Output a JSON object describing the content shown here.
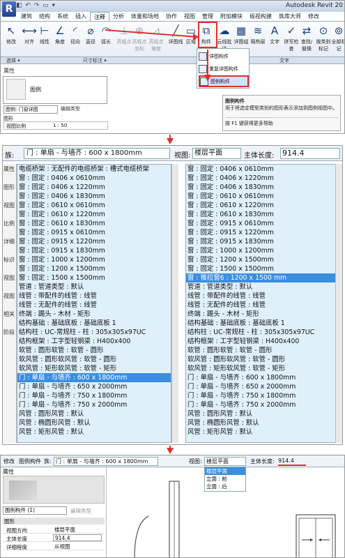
{
  "panel1": {
    "app_title": "Autodesk Revit 20",
    "logo": "R",
    "quick_access": "◧ ↶ ↷ ▭ ▾",
    "ribbon_tabs": [
      "建筑",
      "结构",
      "系统",
      "插入",
      "注释",
      "分析",
      "体量和场地",
      "协作",
      "视图",
      "管理",
      "附加模块",
      "极视构建",
      "族库大师",
      "修改"
    ],
    "ribbon_buttons": [
      {
        "label": "修改",
        "icon": "cursor-icon"
      },
      {
        "label": "对齐",
        "icon": "align-dim-icon"
      },
      {
        "label": "线性",
        "icon": "linear-dim-icon"
      },
      {
        "label": "角度",
        "icon": "angle-dim-icon"
      },
      {
        "label": "径向",
        "icon": "radial-dim-icon"
      },
      {
        "label": "直径",
        "icon": "diameter-dim-icon"
      },
      {
        "label": "弧长",
        "icon": "arc-length-icon"
      },
      {
        "label": "高程点",
        "icon": "spot-elevation-icon"
      },
      {
        "label": "高程点坐标",
        "icon": "spot-coordinate-icon"
      },
      {
        "label": "高程点坡度",
        "icon": "spot-slope-icon"
      },
      {
        "label": "详图线",
        "icon": "detail-line-icon"
      },
      {
        "label": "区域",
        "icon": "region-icon"
      },
      {
        "label": "构件",
        "icon": "component-icon"
      },
      {
        "label": "云线批注",
        "icon": "revision-cloud-icon"
      },
      {
        "label": "详图组",
        "icon": "detail-group-icon"
      },
      {
        "label": "隔热层",
        "icon": "insulation-icon"
      },
      {
        "label": "文字",
        "icon": "text-icon"
      },
      {
        "label": "拼写检查",
        "icon": "spell-check-icon"
      },
      {
        "label": "查找/替换",
        "icon": "find-replace-icon"
      },
      {
        "label": "按类别标记",
        "icon": "tag-by-category-icon"
      },
      {
        "label": "全部标记",
        "icon": "tag-all-icon"
      }
    ],
    "ribbon_groups": [
      "选择 ▾",
      "尺寸标注 ▾",
      "详图",
      "文字"
    ],
    "component_menu": [
      "详图构件",
      "重复详图构件",
      "图例构件"
    ],
    "tooltip": {
      "title": "图例构件",
      "desc": "用于将选定模型类别的图形表示添加到图例视图中。",
      "help": "按 F1 键获得更多帮助"
    },
    "properties": {
      "title": "属性",
      "legend_name": "图例",
      "legend_select": "图例: 门窗详图",
      "edit_type": "编辑类型",
      "category": "图形",
      "view_scale_label": "视图比例",
      "view_scale_value": "1 : 50"
    }
  },
  "panel2": {
    "type_label": "族:",
    "type_value": "门 : 单扇 - 与墙齐 : 600 x 1800mm",
    "view_label": "视图:",
    "view_value": "楼层平面",
    "host_length_label": "主体长度:",
    "host_length_value": "914.4",
    "side_labels": [
      "属性",
      "图形",
      "视图",
      "比例",
      "详细",
      "标识",
      "视图",
      "视图",
      "相关",
      "阶段"
    ],
    "left_list": [
      "电缆桥架 : 无配件的电缆桥架 : 槽式电缆桥架",
      "窗 : 固定 : 0406 x 0610mm",
      "窗 : 固定 : 0406 x 1220mm",
      "窗 : 固定 : 0406 x 1830mm",
      "窗 : 固定 : 0610 x 0610mm",
      "窗 : 固定 : 0610 x 1220mm",
      "窗 : 固定 : 0610 x 1830mm",
      "窗 : 固定 : 0915 x 0610mm",
      "窗 : 固定 : 0915 x 1220mm",
      "窗 : 固定 : 0915 x 1830mm",
      "窗 : 固定 : 1000 x 1200mm",
      "窗 : 固定 : 1200 x 1500mm",
      "窗 : 固定 : 1500 x 1500mm",
      "管道 : 管道类型 : 默认",
      "线管 : 带配件的线管 : 线管",
      "线管 : 无配件的线管 : 线管",
      "终端 : 踢头 - 木材 - 矩形",
      "结构基础 : 基础底板 : 基础底板 1",
      "结构柱 : UC-常规柱 - 柱 : 305x305x97UC",
      "结构框架 : 工字型轻钢梁 : H400x400",
      "软管 : 圆形软管 : 软管 - 圆形",
      "软风管 : 圆形软风管 : 软管 - 圆形",
      "软风管 : 矩形软风管 : 软管 - 矩形",
      "门 : 单扇 - 与墙齐 : 600 x 1800mm",
      "门 : 单扇 - 与墙齐 : 650 x 2000mm",
      "门 : 单扇 - 与墙齐 : 750 x 1800mm",
      "门 : 单扇 - 与墙齐 : 750 x 2000mm",
      "风管 : 圆形风管 : 默认",
      "风管 : 椭圆形风管 : 默认",
      "风管 : 矩形风管 : 默认"
    ],
    "left_selected_index": 23,
    "right_list": [
      "窗 : 固定 : 0406 x 0610mm",
      "窗 : 固定 : 0406 x 1220mm",
      "窗 : 固定 : 0406 x 1830mm",
      "窗 : 固定 : 0610 x 0610mm",
      "窗 : 固定 : 0610 x 1220mm",
      "窗 : 固定 : 0610 x 1830mm",
      "窗 : 固定 : 0915 x 0610mm",
      "窗 : 固定 : 0915 x 1220mm",
      "窗 : 固定 : 0915 x 1830mm",
      "窗 : 固定 : 1000 x 1200mm",
      "窗 : 固定 : 1200 x 1500mm",
      "窗 : 固定 : 1500 x 1500mm",
      "窗 : 推拉窗6 : 1200 x 1500 mm",
      "管道 : 管道类型 : 默认",
      "线管 : 带配件的线管 : 线管",
      "线管 : 无配件的线管 : 线管",
      "终端 : 踢头 - 木材 - 矩形",
      "结构基础 : 基础底板 : 基础底板 1",
      "结构柱 : UC-常规柱 - 柱 : 305x305x97UC",
      "结构框架 : 工字型轻钢梁 : H400x400",
      "软管 : 圆形软管 : 软管 - 圆形",
      "软风管 : 圆形软风管 : 软管 - 圆形",
      "软风管 : 矩形软风管 : 软管 - 矩形",
      "门 : 单扇 - 与墙齐 : 600 x 1800mm",
      "门 : 单扇 - 与墙齐 : 650 x 2000mm",
      "门 : 单扇 - 与墙齐 : 750 x 1800mm",
      "门 : 单扇 - 与墙齐 : 750 x 2000mm",
      "风管 : 圆形风管 : 默认",
      "风管 : 椭圆形风管 : 默认",
      "风管 : 矩形风管 : 默认"
    ],
    "right_selected_index": 12
  },
  "panel3": {
    "modify_label": "修改",
    "context_label": "图例构件",
    "type_label": "族:",
    "type_value": "门 : 单扇 - 与墙齐 : 600 x 1800mm",
    "view_label": "视图:",
    "view_value": "楼层平面",
    "host_length_label": "主体长度:",
    "host_length_value": "914.4",
    "view_options": [
      "楼层平面",
      "立面 : 前",
      "立面 : 后"
    ],
    "view_selected_index": 0,
    "properties": {
      "title": "属性",
      "legend_select": "图例构件 (1)",
      "edit_type": "编辑类型",
      "category": "图形",
      "rows": [
        {
          "key": "视图方向",
          "value": "楼层平面"
        },
        {
          "key": "主体长度",
          "value": "914.4"
        },
        {
          "key": "详细程度",
          "value": "从视图"
        }
      ]
    }
  },
  "colors": {
    "highlight_red": "#e0302e",
    "selection_blue": "#3b8ee0",
    "list_bg": "#dff0fb"
  }
}
